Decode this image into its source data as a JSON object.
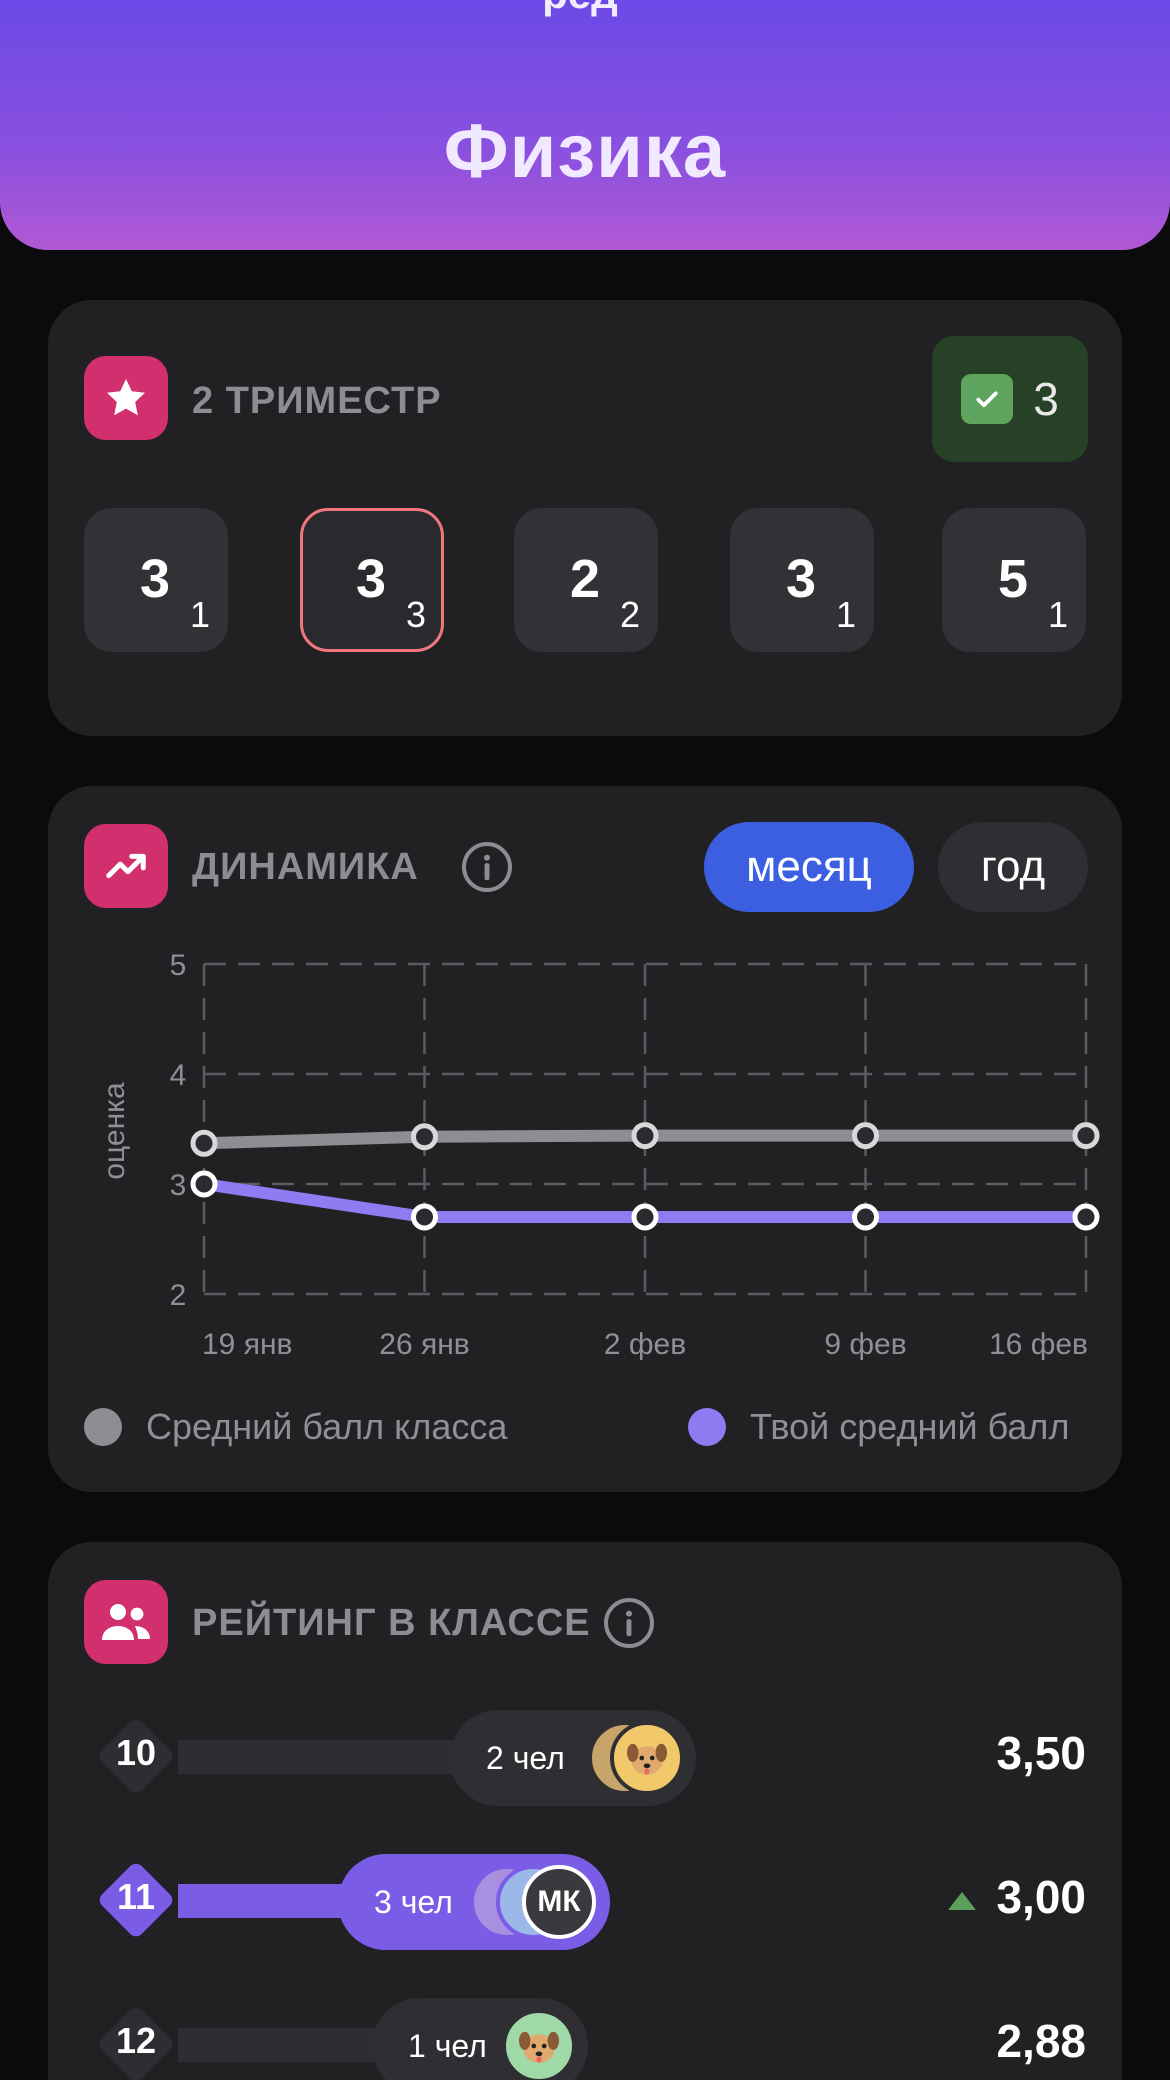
{
  "header": {
    "title": "Физика",
    "cut_text": "ред"
  },
  "term": {
    "title": "2 ТРИМЕСТР",
    "final_grade": "3",
    "grades": [
      {
        "grade": "3",
        "weight": "1",
        "highlighted": false
      },
      {
        "grade": "3",
        "weight": "3",
        "highlighted": true
      },
      {
        "grade": "2",
        "weight": "2",
        "highlighted": false
      },
      {
        "grade": "3",
        "weight": "1",
        "highlighted": false
      },
      {
        "grade": "5",
        "weight": "1",
        "highlighted": false
      }
    ]
  },
  "dynamics": {
    "title": "ДИНАМИКА",
    "toggle": {
      "month": "месяц",
      "year": "год",
      "active": "month"
    },
    "legend": {
      "class_avg": "Средний балл класса",
      "my_avg": "Твой средний балл"
    }
  },
  "chart_data": {
    "type": "line",
    "categories": [
      "19 янв",
      "26 янв",
      "2 фев",
      "9 фев",
      "16 фев"
    ],
    "ylabel": "оценка",
    "yticks": [
      2,
      3,
      4,
      5
    ],
    "ylim": [
      2,
      5
    ],
    "grid": true,
    "legend_position": "bottom",
    "series": [
      {
        "name": "Средний балл класса",
        "color": "#8e8e92",
        "values": [
          3.37,
          3.43,
          3.44,
          3.44,
          3.44
        ]
      },
      {
        "name": "Твой средний балл",
        "color": "#8f7cf2",
        "values": [
          3.0,
          2.7,
          2.7,
          2.7,
          2.7
        ]
      }
    ]
  },
  "rating": {
    "title": "РЕЙТИНГ В КЛАССЕ",
    "rows": [
      {
        "place": "10",
        "people": "2 чел",
        "score": "3,50",
        "active": false,
        "trend_up": false
      },
      {
        "place": "11",
        "people": "3 чел",
        "score": "3,00",
        "active": true,
        "trend_up": true,
        "initials": "МК"
      },
      {
        "place": "12",
        "people": "1 чел",
        "score": "2,88",
        "active": false,
        "trend_up": false
      }
    ]
  },
  "colors": {
    "accent_pink": "#d12f6d",
    "accent_blue": "#3b5fe0",
    "accent_violet": "#7b5ce6",
    "success_green": "#5ea35e"
  }
}
